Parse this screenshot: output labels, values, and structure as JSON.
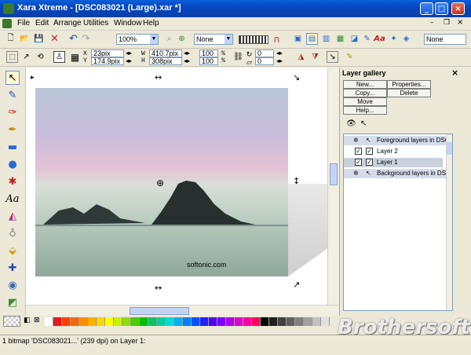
{
  "window": {
    "title": "Xara Xtreme - [DSC083021 (Large).xar *]"
  },
  "menu": [
    "File",
    "Edit",
    "Arrange",
    "Utilities",
    "Window",
    "Help"
  ],
  "toolbar1": {
    "zoom_value": "100%",
    "quality_value": "None",
    "feather_value": "None"
  },
  "toolbar2": {
    "x_label": "X",
    "x_value": "23pix",
    "y_label": "Y",
    "y_value": "174.9pix",
    "w_label": "W",
    "w_value": "410.7pix",
    "h_label": "H",
    "h_value": "308pix",
    "scale_w": "100",
    "scale_h": "100",
    "pct1": "%",
    "pct2": "%",
    "angle": "0",
    "skew": "0"
  },
  "canvas": {
    "photo_caption": "softonic.com"
  },
  "gallery": {
    "title": "Layer gallery",
    "buttons": {
      "new": "New...",
      "properties": "Properties...",
      "copy": "Copy...",
      "delete": "Delete",
      "move": "Move",
      "help": "Help..."
    },
    "rows": [
      {
        "label": "Foreground layers in DSC",
        "checked": false
      },
      {
        "label": "Layer 2",
        "checked": true
      },
      {
        "label": "Layer 1",
        "checked": true
      },
      {
        "label": "Background layers in DSC",
        "checked": false
      }
    ]
  },
  "colors": {
    "palette": [
      "#ffffff",
      "#e31a1c",
      "#ff4000",
      "#ff6600",
      "#ff8c00",
      "#ffb000",
      "#ffd400",
      "#ffff00",
      "#c8f000",
      "#8ce000",
      "#4ccc00",
      "#00c000",
      "#00c860",
      "#00d0a0",
      "#00d8d8",
      "#00b0f0",
      "#0080ff",
      "#0050ff",
      "#2020ff",
      "#5000ff",
      "#8000ff",
      "#b000f0",
      "#e000d0",
      "#ff00a0",
      "#ff0060",
      "#000000",
      "#202020",
      "#404040",
      "#606060",
      "#808080",
      "#a0a0a0",
      "#c0c0c0",
      "#e0e0e0"
    ],
    "accent": "#0546c0"
  },
  "statusbar": {
    "text": "1 bitmap 'DSC083021...' (239 dpi) on Layer 1:"
  },
  "watermark": "Brothersoft"
}
